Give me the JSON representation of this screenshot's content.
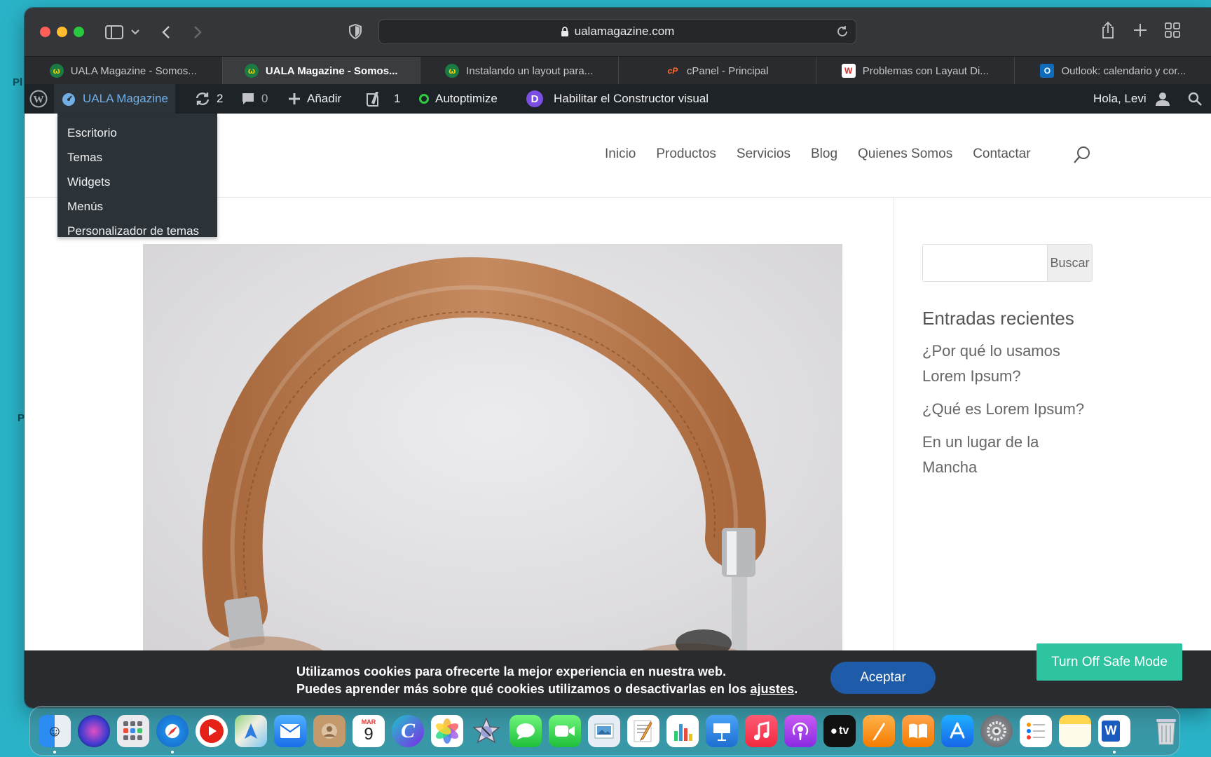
{
  "desktop": {
    "edge_text_1": "Pl",
    "edge_text_2": "P"
  },
  "browser": {
    "url": "ualamagazine.com",
    "tabs": [
      {
        "label": "UALA Magazine - Somos...",
        "favicon": "uala-favicon",
        "fav_text": "ω",
        "active": false
      },
      {
        "label": "UALA Magazine - Somos...",
        "favicon": "uala-favicon",
        "fav_text": "ω",
        "active": true
      },
      {
        "label": "Instalando un layout para...",
        "favicon": "uala-favicon",
        "fav_text": "ω",
        "active": false
      },
      {
        "label": "cPanel - Principal",
        "favicon": "cpanel-favicon",
        "fav_text": "cP",
        "active": false
      },
      {
        "label": "Problemas con Layaut Di...",
        "favicon": "w-favicon",
        "fav_text": "W",
        "active": false
      },
      {
        "label": "Outlook: calendario y cor...",
        "favicon": "outlook-favicon",
        "fav_text": "O",
        "active": false
      }
    ]
  },
  "adminbar": {
    "site_name": "UALA Magazine",
    "updates_count": "2",
    "comments_count": "0",
    "add_label": "Añadir",
    "yoast_count": "1",
    "autoptimize_label": "Autoptimize",
    "divi_letter": "D",
    "visual_builder_label": "Habilitar el Constructor visual",
    "greeting": "Hola, Levi"
  },
  "dropdown": {
    "items": [
      "Escritorio",
      "Temas",
      "Widgets",
      "Menús",
      "Personalizador de temas"
    ]
  },
  "site": {
    "nav": [
      "Inicio",
      "Productos",
      "Servicios",
      "Blog",
      "Quienes Somos",
      "Contactar"
    ],
    "search_button": "Buscar",
    "widget_title": "Entradas recientes",
    "recent_posts": [
      "¿Por qué lo usamos Lorem Ipsum?",
      "¿Qué es Lorem Ipsum?",
      "En un lugar de la Mancha"
    ]
  },
  "cookie": {
    "line1": "Utilizamos cookies para ofrecerte la mejor experiencia en nuestra web.",
    "line2_prefix": "Puedes aprender más sobre qué cookies utilizamos o desactivarlas en los ",
    "line2_link": "ajustes",
    "line2_suffix": ".",
    "accept_label": "Aceptar"
  },
  "safe_mode": {
    "label": "Turn Off Safe Mode"
  },
  "dock": {
    "calendar_month": "MAR",
    "calendar_day": "9",
    "tv_label": "tv",
    "word_letter": "W",
    "apps": [
      "Finder",
      "Siri",
      "Launchpad",
      "Safari",
      "YouTube",
      "Maps",
      "Mail",
      "Contacts",
      "Calendar",
      "Canva",
      "Photos",
      "Instruments",
      "Messages",
      "FaceTime",
      "Preview",
      "TextEdit",
      "Numbers",
      "Keynote",
      "Music",
      "Podcasts",
      "TV",
      "Pages",
      "Books",
      "App Store",
      "System Preferences",
      "Reminders",
      "Notes",
      "Word",
      "Trash"
    ]
  },
  "colors": {
    "accent_blue": "#72aee6",
    "safe_mode_green": "#2ec4a0",
    "accept_blue": "#1e5ba8",
    "adminbar_bg": "#1d2327"
  }
}
